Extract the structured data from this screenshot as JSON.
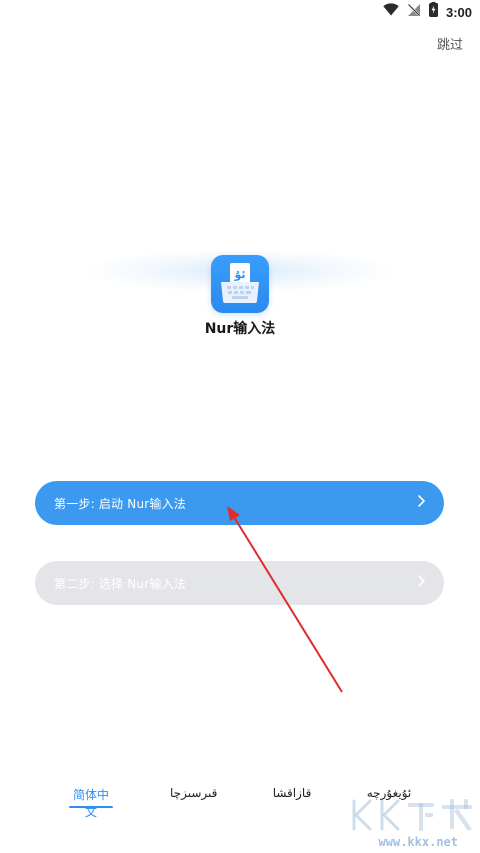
{
  "status_bar": {
    "time": "3:00",
    "icons": [
      "wifi-icon",
      "no-signal-icon",
      "battery-icon"
    ]
  },
  "header": {
    "skip_label": "跳过"
  },
  "app": {
    "name": "Nur输入法",
    "logo_icon": "keyboard-logo-icon",
    "logo_text": "ئۇ",
    "accent": "#3b9af0"
  },
  "steps": [
    {
      "label": "第一步: 启动 Nur输入法",
      "state": "active",
      "color": "#3b9af0"
    },
    {
      "label": "第二步: 选择 Nur输入法",
      "state": "disabled",
      "color": "#e4e5e9"
    }
  ],
  "languages": {
    "tabs": [
      {
        "label": "简体中文",
        "active": true
      },
      {
        "label": "قىرسىزچا",
        "active": false
      },
      {
        "label": "قازاقشا",
        "active": false
      },
      {
        "label": "ئۇيغۇرچە",
        "active": false
      }
    ],
    "active_color": "#2f8ef0"
  },
  "watermark": {
    "brand": "KK下载",
    "url": "www.kkx.net"
  }
}
